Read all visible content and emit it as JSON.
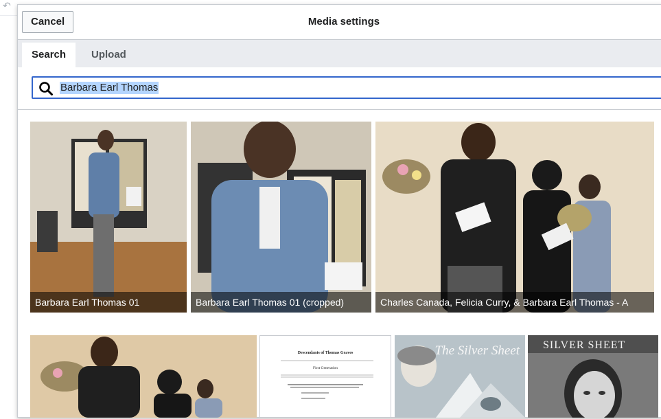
{
  "dialog": {
    "title": "Media settings",
    "cancel_label": "Cancel"
  },
  "tabs": [
    {
      "label": "Search",
      "active": true
    },
    {
      "label": "Upload",
      "active": false
    }
  ],
  "search": {
    "value": "Barbara Earl Thomas",
    "icon": "search-icon"
  },
  "results": [
    {
      "caption": "Barbara Earl Thomas 01"
    },
    {
      "caption": "Barbara Earl Thomas 01 (cropped)"
    },
    {
      "caption": "Charles Canada, Felicia Curry, & Barbara Earl Thomas - A"
    },
    {
      "caption": ""
    },
    {
      "caption": "",
      "doc_title": "Descendants of Thomas Graves",
      "doc_subtitle": "First Generation"
    },
    {
      "caption": "",
      "cover_text": "The Silver Sheet"
    },
    {
      "caption": "",
      "cover_text": "SILVER SHEET"
    }
  ],
  "colors": {
    "accent": "#3366cc",
    "tab_bar": "#eaecf0",
    "selection": "#b4d5fe"
  }
}
